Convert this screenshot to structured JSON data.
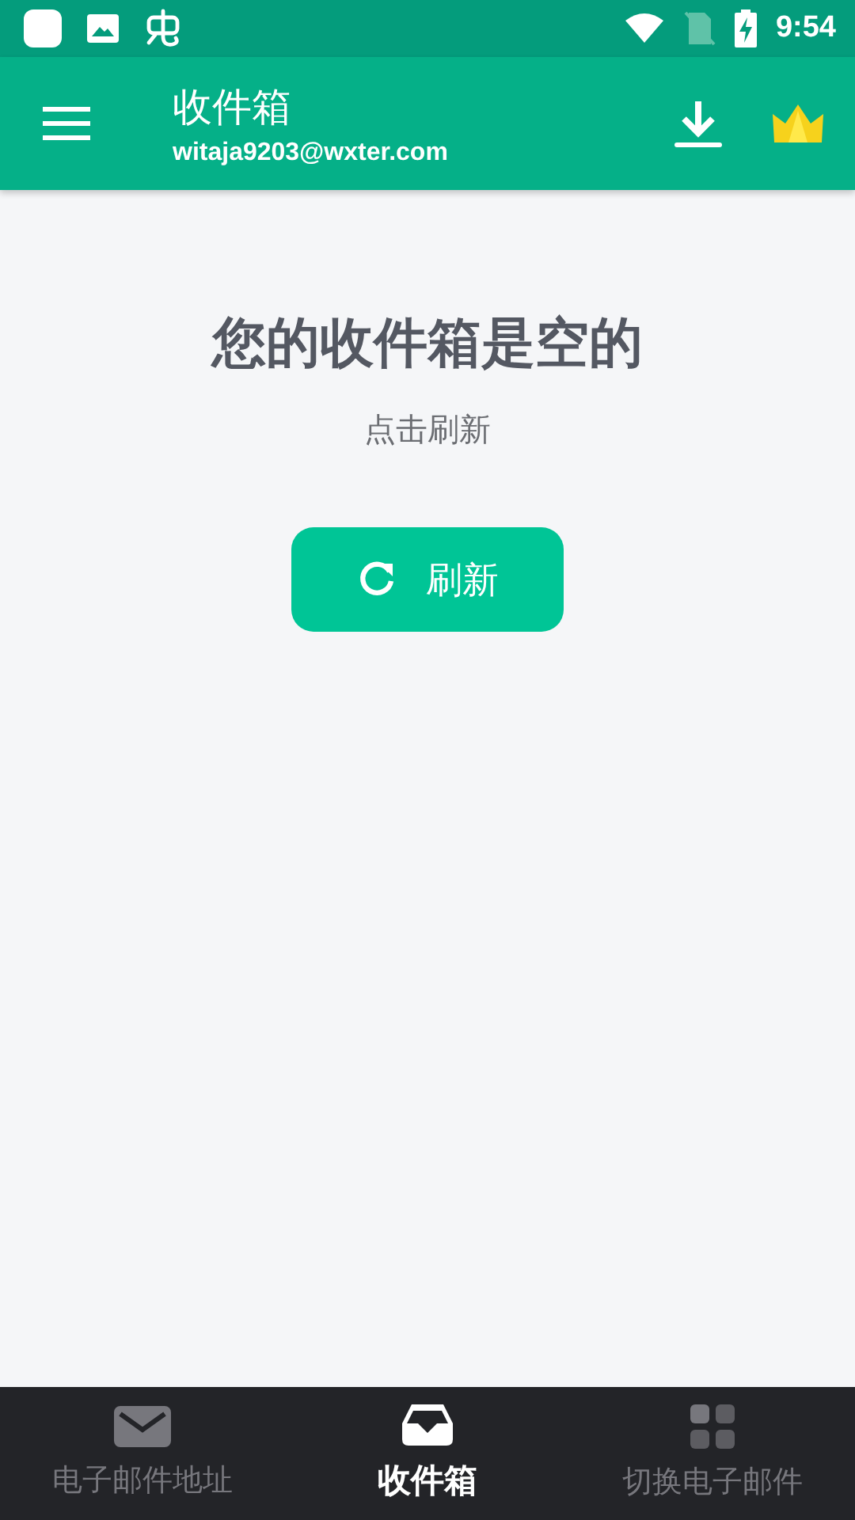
{
  "status_bar": {
    "time": "9:54"
  },
  "app_bar": {
    "title": "收件箱",
    "subtitle": "witaja9203@wxter.com"
  },
  "empty_state": {
    "title": "您的收件箱是空的",
    "hint": "点击刷新",
    "button": "刷新"
  },
  "bottom_nav": [
    {
      "kind": "mail",
      "label": "电子邮件地址",
      "selected": false
    },
    {
      "kind": "inbox",
      "label": "收件箱",
      "selected": true
    },
    {
      "kind": "grid",
      "label": "切换电子邮件",
      "selected": false
    }
  ]
}
